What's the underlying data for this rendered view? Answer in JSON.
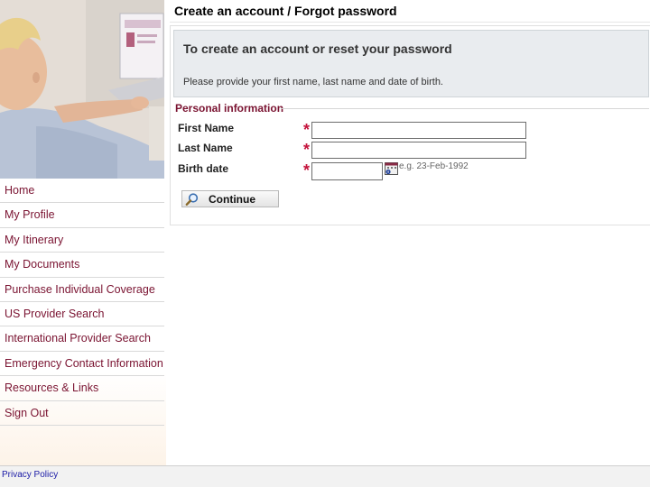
{
  "header": {
    "title": "Create an account / Forgot password"
  },
  "sidebar": {
    "nav_items": [
      {
        "label": "Home"
      },
      {
        "label": "My Profile"
      },
      {
        "label": "My Itinerary"
      },
      {
        "label": "My Documents"
      },
      {
        "label": "Purchase Individual Coverage"
      },
      {
        "label": "US Provider Search"
      },
      {
        "label": "International Provider Search"
      },
      {
        "label": "Emergency Contact Information"
      },
      {
        "label": "Resources & Links"
      },
      {
        "label": "Sign Out"
      }
    ]
  },
  "notice": {
    "heading": "To create an account or reset your password",
    "text": "Please provide your first name, last name and date of birth."
  },
  "form": {
    "section_title": "Personal information",
    "first_name": {
      "label": "First Name",
      "value": ""
    },
    "last_name": {
      "label": "Last Name",
      "value": ""
    },
    "birth_date": {
      "label": "Birth date",
      "value": "",
      "hint": "e.g. 23-Feb-1992"
    },
    "continue_label": "Continue"
  },
  "footer": {
    "privacy_label": "Privacy Policy"
  },
  "colors": {
    "accent": "#7a1331",
    "required": "#c4143c",
    "link": "#1a1aa6"
  }
}
